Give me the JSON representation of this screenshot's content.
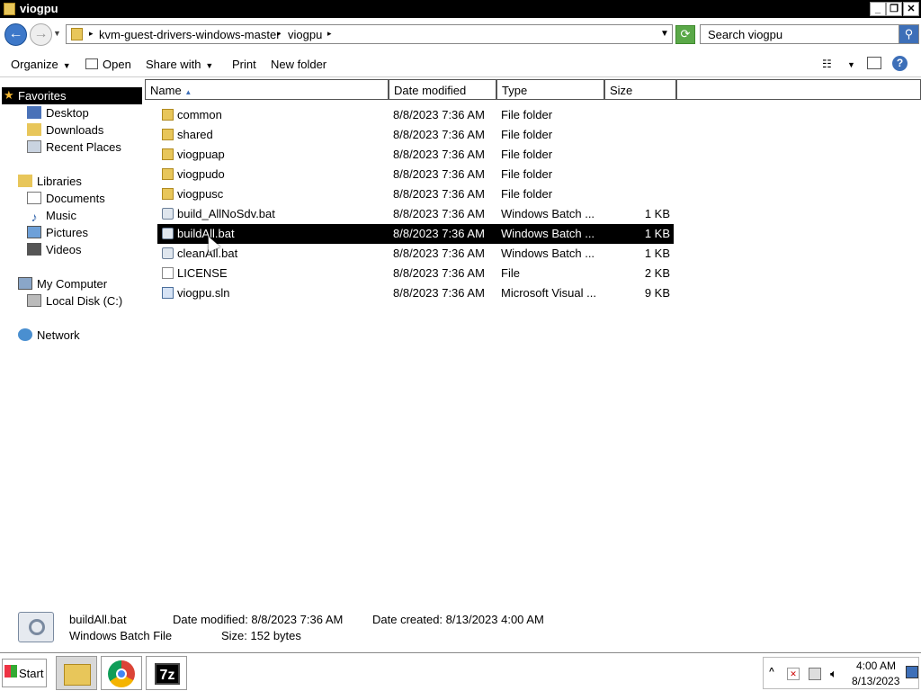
{
  "window": {
    "title": "viogpu"
  },
  "address": {
    "crumbs": [
      "kvm-guest-drivers-windows-master",
      "viogpu"
    ],
    "search_placeholder": "Search viogpu"
  },
  "toolbar": {
    "organize": "Organize",
    "open": "Open",
    "share_with": "Share with",
    "print": "Print",
    "new_folder": "New folder"
  },
  "nav": {
    "favorites": "Favorites",
    "desktop": "Desktop",
    "downloads": "Downloads",
    "recent_places": "Recent Places",
    "libraries": "Libraries",
    "documents": "Documents",
    "music": "Music",
    "pictures": "Pictures",
    "videos": "Videos",
    "my_computer": "My Computer",
    "local_disk": "Local Disk (C:)",
    "network": "Network"
  },
  "columns": {
    "name": "Name",
    "date_modified": "Date modified",
    "type": "Type",
    "size": "Size"
  },
  "files": [
    {
      "name": "common",
      "date": "8/8/2023 7:36 AM",
      "type": "File folder",
      "size": "",
      "icon": "folder-icon"
    },
    {
      "name": "shared",
      "date": "8/8/2023 7:36 AM",
      "type": "File folder",
      "size": "",
      "icon": "folder-icon"
    },
    {
      "name": "viogpuap",
      "date": "8/8/2023 7:36 AM",
      "type": "File folder",
      "size": "",
      "icon": "folder-icon"
    },
    {
      "name": "viogpudo",
      "date": "8/8/2023 7:36 AM",
      "type": "File folder",
      "size": "",
      "icon": "folder-icon"
    },
    {
      "name": "viogpusc",
      "date": "8/8/2023 7:36 AM",
      "type": "File folder",
      "size": "",
      "icon": "folder-icon"
    },
    {
      "name": "build_AllNoSdv.bat",
      "date": "8/8/2023 7:36 AM",
      "type": "Windows Batch ...",
      "size": "1 KB",
      "icon": "batch-file-icon"
    },
    {
      "name": "buildAll.bat",
      "date": "8/8/2023 7:36 AM",
      "type": "Windows Batch ...",
      "size": "1 KB",
      "icon": "batch-file-icon",
      "selected": true
    },
    {
      "name": "cleanAll.bat",
      "date": "8/8/2023 7:36 AM",
      "type": "Windows Batch ...",
      "size": "1 KB",
      "icon": "batch-file-icon"
    },
    {
      "name": "LICENSE",
      "date": "8/8/2023 7:36 AM",
      "type": "File",
      "size": "2 KB",
      "icon": "file-icon"
    },
    {
      "name": "viogpu.sln",
      "date": "8/8/2023 7:36 AM",
      "type": "Microsoft Visual ...",
      "size": "9 KB",
      "icon": "solution-file-icon"
    }
  ],
  "details": {
    "name": "buildAll.bat",
    "type": "Windows Batch File",
    "date_modified": "Date modified: 8/8/2023 7:36 AM",
    "date_created": "Date created: 8/13/2023 4:00 AM",
    "size": "Size: 152 bytes"
  },
  "taskbar": {
    "start": "Start",
    "time": "4:00 AM",
    "date": "8/13/2023"
  }
}
